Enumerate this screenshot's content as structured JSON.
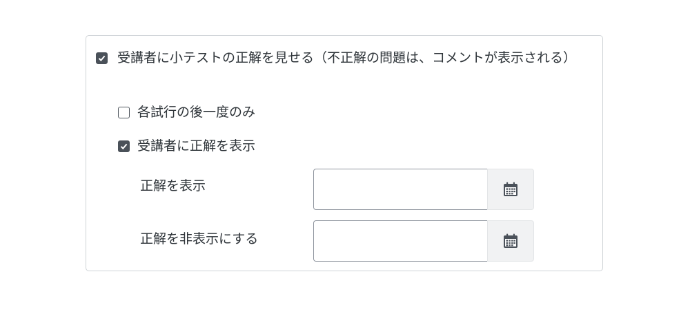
{
  "options": {
    "show_answers": {
      "label": "受講者に小テストの正解を見せる（不正解の問題は、コメントが表示される）",
      "checked": true
    },
    "once_per_attempt": {
      "label": "各試行の後一度のみ",
      "checked": false
    },
    "show_to_students": {
      "label": "受講者に正解を表示",
      "checked": true
    }
  },
  "dates": {
    "show_answers_at": {
      "label": "正解を表示",
      "value": "",
      "icon": "calendar-icon"
    },
    "hide_answers_at": {
      "label": "正解を非表示にする",
      "value": "",
      "icon": "calendar-icon"
    }
  },
  "colors": {
    "checkbox_checked": "#4a5159",
    "panel_border": "#cfd3d7",
    "calendar_button_bg": "#f1f2f3"
  }
}
